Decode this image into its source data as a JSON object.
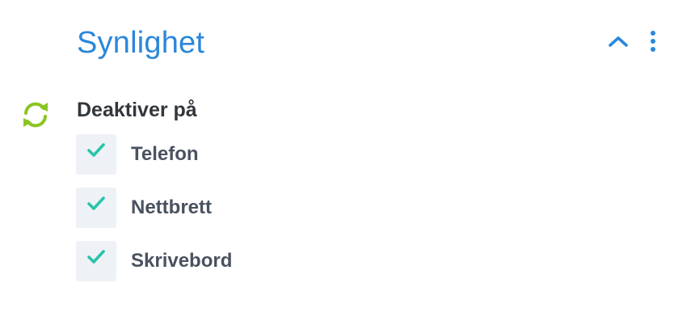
{
  "section": {
    "title": "Synlighet",
    "collapse_icon": "chevron-up-icon",
    "more_icon": "kebab-menu-icon"
  },
  "field": {
    "label": "Deaktiver på",
    "reset_icon": "refresh-icon",
    "options": [
      {
        "label": "Telefon",
        "checked": true
      },
      {
        "label": "Nettbrett",
        "checked": true
      },
      {
        "label": "Skrivebord",
        "checked": true
      }
    ]
  },
  "colors": {
    "title": "#2b87da",
    "accent": "#2b87da",
    "check": "#29c4a9",
    "reset": "#8bc524",
    "checkbox_bg": "#eef2f6",
    "label": "#32373c"
  }
}
